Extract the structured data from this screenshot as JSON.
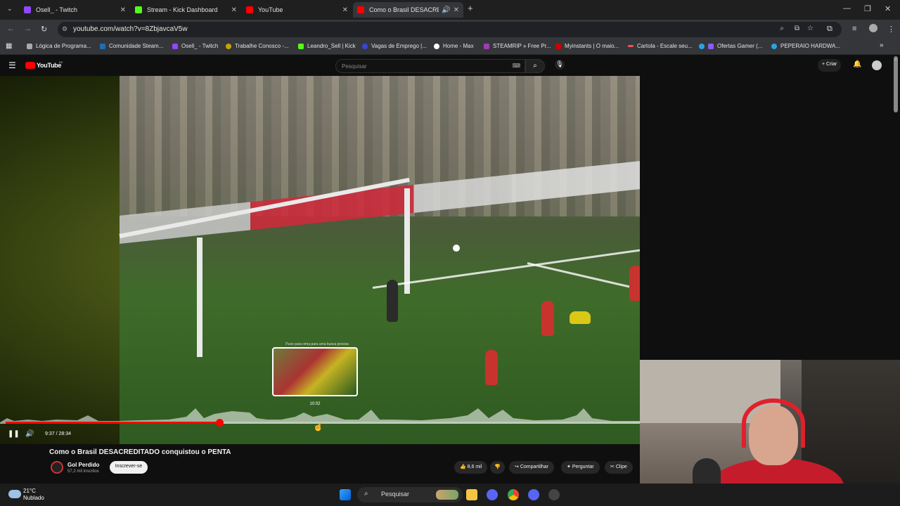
{
  "browser": {
    "tabs": [
      {
        "title": "Osell_ - Twitch",
        "color": "#9146ff"
      },
      {
        "title": "Stream - Kick Dashboard",
        "color": "#53fc18"
      },
      {
        "title": "YouTube",
        "color": "#ff0000"
      },
      {
        "title": "Como o Brasil DESACREDITADO",
        "color": "#ff0000"
      }
    ],
    "new_tab": "+",
    "url": "youtube.com/watch?v=8ZbjavcaV5w",
    "bookmarks": [
      "Lógica de Programa...",
      "Comunidade Steam...",
      "Osell_ - Twitch",
      "Trabalhe Conosco -...",
      "Leandro_Sell | Kick",
      "Vagas de Emprego |...",
      "Home - Max",
      "STEAMRIP » Free Pr...",
      "Myinstants | O maio...",
      "Cartola - Escale seu...",
      "Ofertas Gamer (...",
      "PEPERAIO HARDWA..."
    ]
  },
  "youtube": {
    "logo": "YouTube",
    "region": "BR",
    "search_placeholder": "Pesquisar",
    "create_label": "Criar",
    "video_title": "Como o Brasil DESACREDITADO conquistou o PENTA",
    "channel_name": "Gol Perdido",
    "channel_subs": "57,2 mil inscritos",
    "subscribe_label": "Inscrever-se",
    "likes": "8,6 mil",
    "share_label": "Compartilhar",
    "ask_label": "Perguntar",
    "clip_label": "Clipe",
    "time_display": "9:37 / 28:34",
    "progress_fraction": 0.337,
    "preview_tip": "Puxe para cima para uma busca precisa",
    "preview_time": "10:02"
  },
  "taskbar": {
    "temperature": "21°C",
    "weather": "Nublado",
    "search_label": "Pesquisar"
  }
}
